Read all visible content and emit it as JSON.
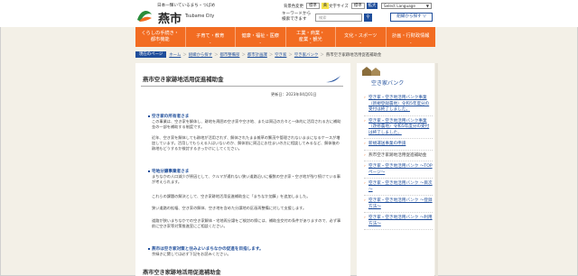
{
  "header": {
    "tagline": "日本一輝いているまち・つばめ",
    "city_name": "燕市",
    "city_name_en": "Tsubame City",
    "bg_label": "背景色変更",
    "bg_options": [
      "標準",
      "黄"
    ],
    "font_label": "文字サイズ",
    "font_options": [
      "標準",
      "拡大"
    ],
    "language_select": "Select Language",
    "keyword_label": "キーワードから\n検索できます",
    "search_placeholder": "検索",
    "search_icon": "search-icon",
    "org_button": "組織から探す"
  },
  "nav": {
    "items": [
      "くらしの手続き・\n都市機能",
      "子育て・教育",
      "健康・福祉・医療",
      "工業・商業・\n産業・観光",
      "文化・スポーツ",
      "計画・行財政情報"
    ]
  },
  "breadcrumb": {
    "label": "現在のページ",
    "items": [
      "ホーム",
      "組織から探す",
      "都市整備部",
      "都市計画課",
      "空き家",
      "空き家バンク"
    ],
    "current": "燕市空き家跡地活用促進補助金"
  },
  "main": {
    "title": "燕市空き家跡地活用促進補助金",
    "updated": "更新日：2023年04月01日",
    "sections": [
      {
        "heading": "空き家の所有者さま",
        "paragraphs": [
          "この事業は、空き家を解体し、跡地を周囲の空き家や空き地、または周辺の方々と一体的に活用される方に補助金の一部を補助する制度です。",
          "近年、空き家を解体しても跡地が活用されず、解体されたまま雑草の繁茂や管理されないままになるケースが増加しています。活用してもらえる人はいないのか、解体前に周辺にお住まいの方に相談してみるなど、解体後の跡地もどうするか検討するきっかけにしてください。"
        ]
      },
      {
        "heading": "宅地分譲事業者さま",
        "paragraphs": [
          "まちなかの人口減少が原因として、クルマが通れない狭い道路沿いに複数の空き家・空き地が残り続けている事が考えられます。",
          "これらの課題の解決として、空き家跡地活用促進補助金に「まちなか加算」を追加しました。",
          "狭い道路の拡幅、空き家の解体、空き地を含めた分譲地の区画再整備に対して支援します。",
          "道路が狭いまちなかでの空き家解体・宅地再分譲をご検討の際には、補助金交付の条件がありますので、必ず事前に空き家等対策推進室にご相談ください。"
        ]
      },
      {
        "heading": "燕市は空き家対策と住みよいまちなかの促進を目指します。",
        "paragraphs": [
          "余緑きに関しては必ず下記をお読みください。"
        ]
      }
    ],
    "section2_title": "燕市空き家跡地活用促進補助金"
  },
  "sidebar": {
    "title": "空き家バンク",
    "links": [
      {
        "text": "空き家・空き地活用バンク事業（新規登録農地）令和5年度分の受付は終了しました。",
        "plain": false
      },
      {
        "text": "空き家・空き地活用バンク事業（改修農地）令和5年度分の受付は終了しました。",
        "plain": false
      },
      {
        "text": "新規運送事業の申請",
        "plain": false
      },
      {
        "text": "燕市空き家跡地活用促進補助金",
        "plain": true
      },
      {
        "text": "空き家・空き地活用バンク ～TOPページ～",
        "plain": false
      },
      {
        "text": "空き家・空き地活用バンク ～目次～",
        "plain": false
      },
      {
        "text": "空き家・空き地活用バンク ～登録方法～",
        "plain": false
      },
      {
        "text": "空き家・空き地活用バンク ～利用方法～",
        "plain": false
      }
    ]
  },
  "colors": {
    "accent_orange": "#f26c22",
    "brand_blue": "#1f4e9b",
    "background": "#f3f0e7"
  }
}
